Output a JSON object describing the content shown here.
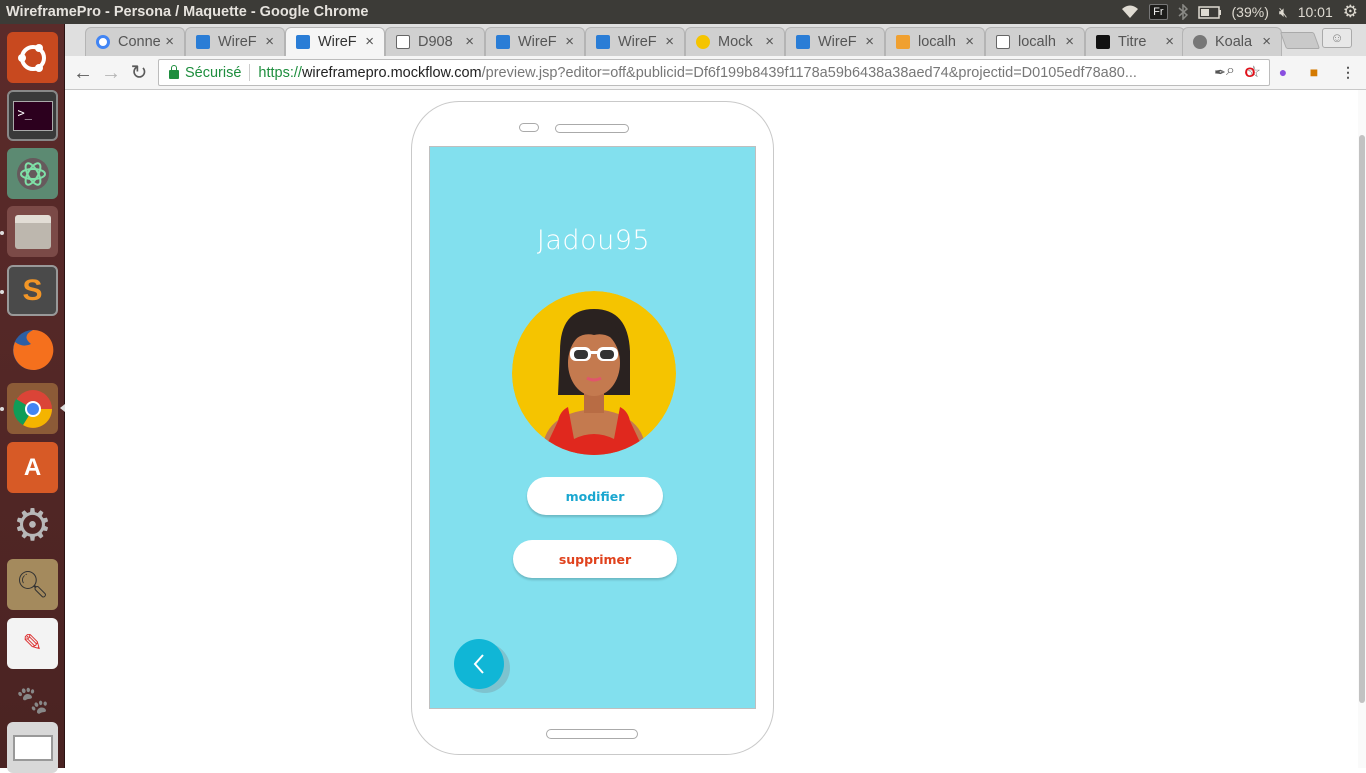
{
  "window": {
    "title": "WireframePro - Persona / Maquette - Google Chrome"
  },
  "system": {
    "keyboard_layout": "Fr",
    "battery": "(39%)",
    "time": "10:01"
  },
  "launcher": {
    "items": [
      "ubuntu-dash-icon",
      "terminal-icon",
      "atom-icon",
      "files-icon",
      "sublime-text-icon",
      "firefox-icon",
      "chrome-icon",
      "software-center-icon",
      "system-settings-icon",
      "image-viewer-icon",
      "document-viewer-icon",
      "gimp-icon",
      "screenshot-icon"
    ]
  },
  "tabs": [
    {
      "label": "Conne",
      "icon": "google-icon"
    },
    {
      "label": "WireF",
      "icon": "wireframepro-icon"
    },
    {
      "label": "WireF",
      "icon": "wireframepro-icon"
    },
    {
      "label": "D908",
      "icon": "page-icon"
    },
    {
      "label": "WireF",
      "icon": "wireframepro-icon"
    },
    {
      "label": "WireF",
      "icon": "wireframepro-icon"
    },
    {
      "label": "Mock",
      "icon": "mockflow-icon"
    },
    {
      "label": "WireF",
      "icon": "wireframepro-icon"
    },
    {
      "label": "localh",
      "icon": "phpmyadmin-icon"
    },
    {
      "label": "localh",
      "icon": "page-icon"
    },
    {
      "label": "Titre",
      "icon": "trello-icon"
    },
    {
      "label": "Koala",
      "icon": "koala-icon"
    }
  ],
  "address_bar": {
    "secure_label": "Sécurisé",
    "scheme": "https://",
    "host": "wireframepro.mockflow.com",
    "path": "/preview.jsp?editor=off&publicid=Df6f199b8439f1178a59b6438a38aed74&projectid=D0105edf78a80..."
  },
  "screen": {
    "username": "Jadou95",
    "modify_label": "modifier",
    "delete_label": "supprimer",
    "background_color": "#82e0ee",
    "accent_color": "#10b6d6",
    "modify_color": "#1aa7d0",
    "delete_color": "#e0421d"
  }
}
